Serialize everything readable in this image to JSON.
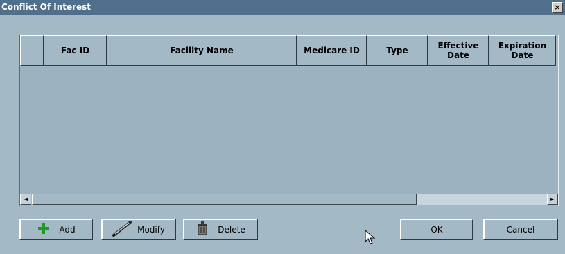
{
  "window": {
    "title": "Conflict Of Interest",
    "close_label": "×"
  },
  "grid": {
    "columns": [
      "",
      "Fac ID",
      "Facility Name",
      "Medicare ID",
      "Type",
      "Effective Date",
      "Expiration Date"
    ],
    "rows": []
  },
  "scrollbar": {
    "left_arrow": "◄",
    "right_arrow": "►"
  },
  "buttons": {
    "add": "Add",
    "modify": "Modify",
    "delete": "Delete",
    "ok": "OK",
    "cancel": "Cancel"
  },
  "icons": {
    "add": "plus-icon",
    "modify": "pen-icon",
    "delete": "trash-icon"
  },
  "colors": {
    "background": "#a3b9c6",
    "titlebar": "#4f6f8d",
    "add_icon": "#1c9a25"
  }
}
